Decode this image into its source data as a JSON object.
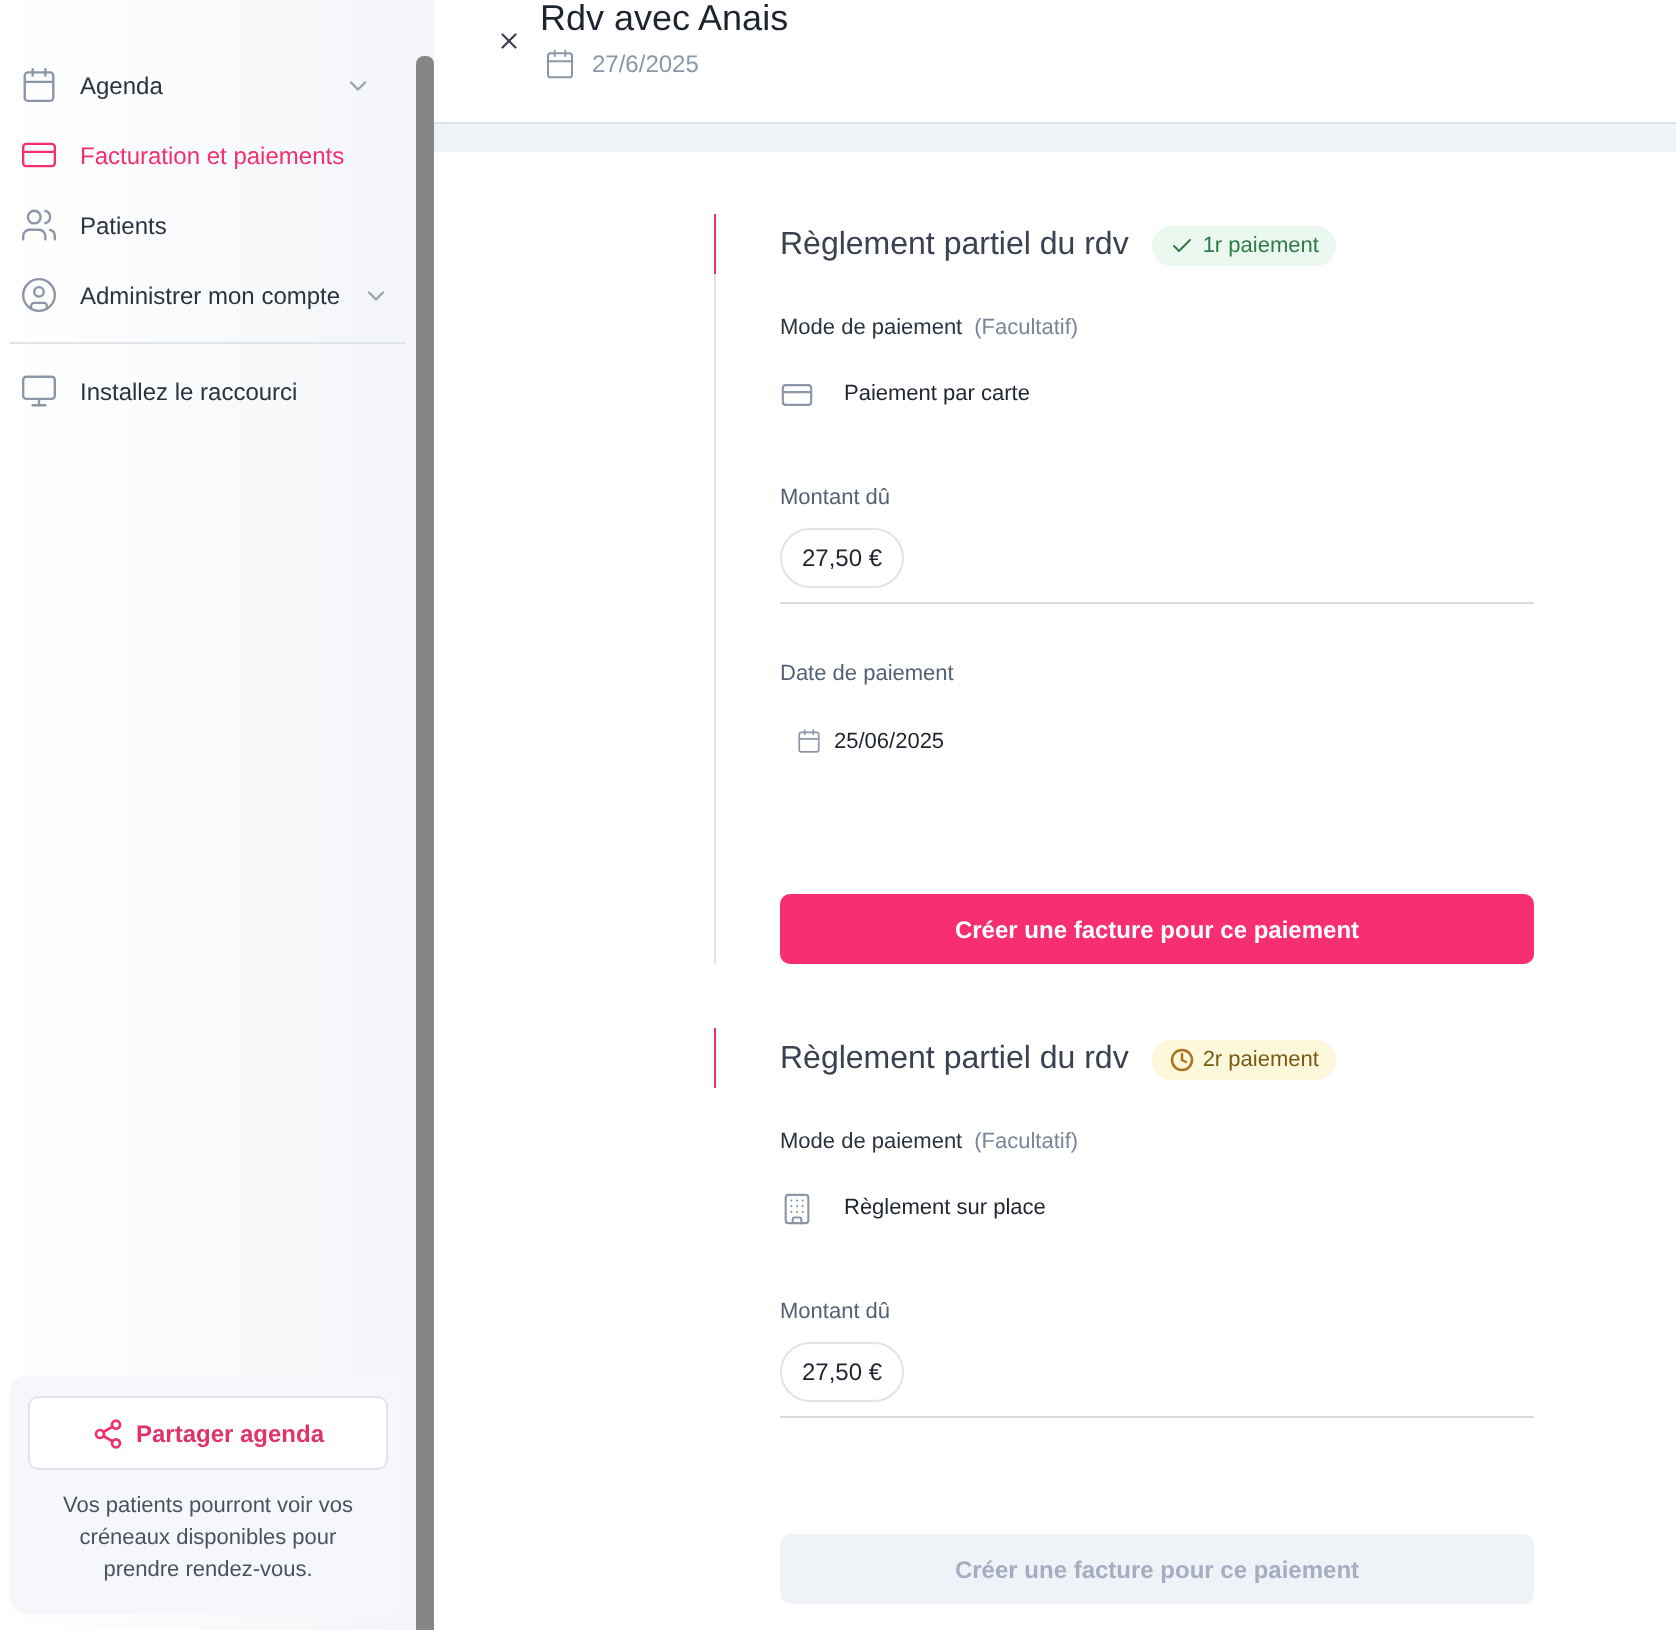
{
  "sidebar": {
    "items": [
      {
        "kind": "calendar",
        "label": "Agenda",
        "selected": false,
        "expandable": true
      },
      {
        "kind": "card",
        "label": "Facturation et paiements",
        "selected": true,
        "expandable": false
      },
      {
        "kind": "people",
        "label": "Patients",
        "selected": false,
        "expandable": false
      },
      {
        "kind": "user",
        "label": "Administrer mon compte",
        "selected": false,
        "expandable": true
      }
    ],
    "extra_items": [
      {
        "kind": "monitor",
        "label": "Installez le raccourci"
      }
    ],
    "share": {
      "button": "Partager agenda",
      "text": "Vos patients pourront voir vos créneaux disponibles pour prendre rendez-vous."
    }
  },
  "header": {
    "title": "Rdv avec Anais",
    "date": "27/6/2025"
  },
  "payments": [
    {
      "title": "Règlement partiel du rdv",
      "kind": "done",
      "badge": "1r paiement",
      "mode_label": "Mode de paiement",
      "mode_hint": "(Facultatif)",
      "method": {
        "kind": "card",
        "label": "Paiement par carte"
      },
      "amount_label": "Montant dû",
      "amount": "27,50 €",
      "date_label": "Date de paiement",
      "date": "25/06/2025",
      "button": "Créer une facture pour ce paiement",
      "button_disabled": false
    },
    {
      "title": "Règlement partiel du rdv",
      "kind": "pending",
      "badge": "2r paiement",
      "mode_label": "Mode de paiement",
      "mode_hint": "(Facultatif)",
      "method": {
        "kind": "building",
        "label": "Règlement sur place"
      },
      "amount_label": "Montant dû",
      "amount": "27,50 €",
      "button": "Créer une facture pour ce paiement",
      "button_disabled": true
    }
  ]
}
